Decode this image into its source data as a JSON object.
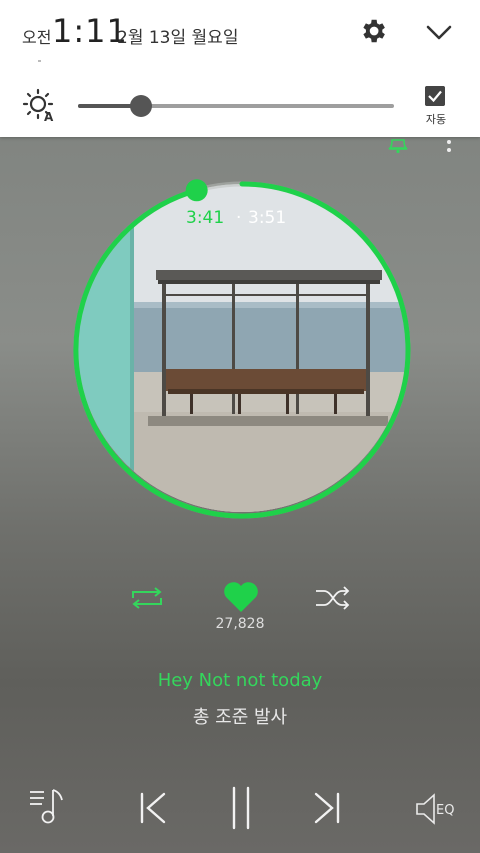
{
  "status": {
    "ampm": "오전",
    "time": "1:11",
    "date": "2월 13일 월요일"
  },
  "quick_settings": {
    "settings_icon": "gear-icon",
    "collapse_icon": "chevron-down-icon",
    "brightness_icon": "auto-brightness-icon",
    "brightness_level": 0.2,
    "auto_label": "자동",
    "auto_checked": true
  },
  "player": {
    "current_time": "3:41",
    "separator": "·",
    "total_time": "3:51",
    "progress": 0.956,
    "likes": "27,828",
    "lyric_current": "Hey Not not today",
    "lyric_next": "총 조준 발사",
    "accent_color": "#1fd14a",
    "icons": {
      "repeat": "repeat-icon",
      "like": "heart-icon",
      "shuffle": "shuffle-icon",
      "playlist": "playlist-icon",
      "prev": "previous-icon",
      "pause": "pause-icon",
      "next": "next-icon",
      "eq": "equalizer-icon",
      "alarm": "bell-icon",
      "more": "more-icon"
    }
  }
}
